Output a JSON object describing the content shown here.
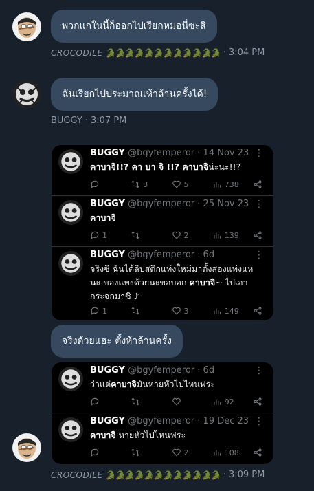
{
  "messages": [
    {
      "text": "พวกแกในนี้ก็ออกไปเรียกหมอนี่ซะสิ"
    },
    {
      "text": "ฉันเรียกไปประมาณเห้าล้านครั้งได้!"
    },
    {
      "text": "จริงด้วยแฮะ ตั้งห้าล้านครั้ง"
    }
  ],
  "meta": [
    {
      "name": "CROCODILE",
      "emoji": "🐊🐊🐊🐊🐊🐊🐊🐊🐊🐊🐊🐊",
      "sep": "·",
      "time": "3:04 PM"
    },
    {
      "name": "BUGGY",
      "sep": "·",
      "time": "3:07 PM"
    },
    {
      "name": "CROCODILE",
      "emoji": "🐊🐊🐊🐊🐊🐊🐊🐊🐊🐊🐊🐊",
      "sep": "·",
      "time": "3:09 PM"
    }
  ],
  "tweets": [
    {
      "name": "BUGGY",
      "handle": "@bgyfemperor",
      "sep": "·",
      "date": "14 Nov 23",
      "text_a": "คาบาจิ!!?",
      "text_b": " คา บา จิ !!? ",
      "text_c": "คาบาจิ",
      "text_d": "น่ะนะ!!?",
      "replies": "",
      "retweets": "3",
      "likes": "5",
      "views": "738"
    },
    {
      "name": "BUGGY",
      "handle": "@bgyfemperor",
      "sep": "·",
      "date": "25 Nov 23",
      "text_a": "คาบาจิ",
      "replies": "1",
      "retweets": "",
      "likes": "2",
      "views": "139"
    },
    {
      "name": "BUGGY",
      "handle": "@bgyfemperor",
      "sep": "·",
      "date": "6d",
      "text_line1": "จริงซิ ฉันได้ลิปสติกแท่งใหม่มาตั้งสองแท่งแห",
      "text_line2a": "นะ ของแพงด้วยนะขอบอก ",
      "text_line2b": "คาบาจิ",
      "text_line2c": "~ ไปเอา",
      "text_line3": "กระจกมาซิ ♪",
      "replies": "1",
      "retweets": "",
      "likes": "3",
      "views": "149"
    },
    {
      "name": "BUGGY",
      "handle": "@bgyfemperor",
      "sep": "·",
      "date": "6d",
      "text_a": "ว่าแต่",
      "text_b": "คาบาจิ",
      "text_c": "มันหายหัวไปไหนฟระ",
      "replies": "",
      "retweets": "",
      "likes": "",
      "views": "92"
    },
    {
      "name": "BUGGY",
      "handle": "@bgyfemperor",
      "sep": "·",
      "date": "19 Dec 23",
      "text_a": "คาบาจิ",
      "text_b": " หายหัวไปไหนฟระ",
      "replies": "",
      "retweets": "",
      "likes": "2",
      "views": "108"
    }
  ],
  "dots": "⋮"
}
